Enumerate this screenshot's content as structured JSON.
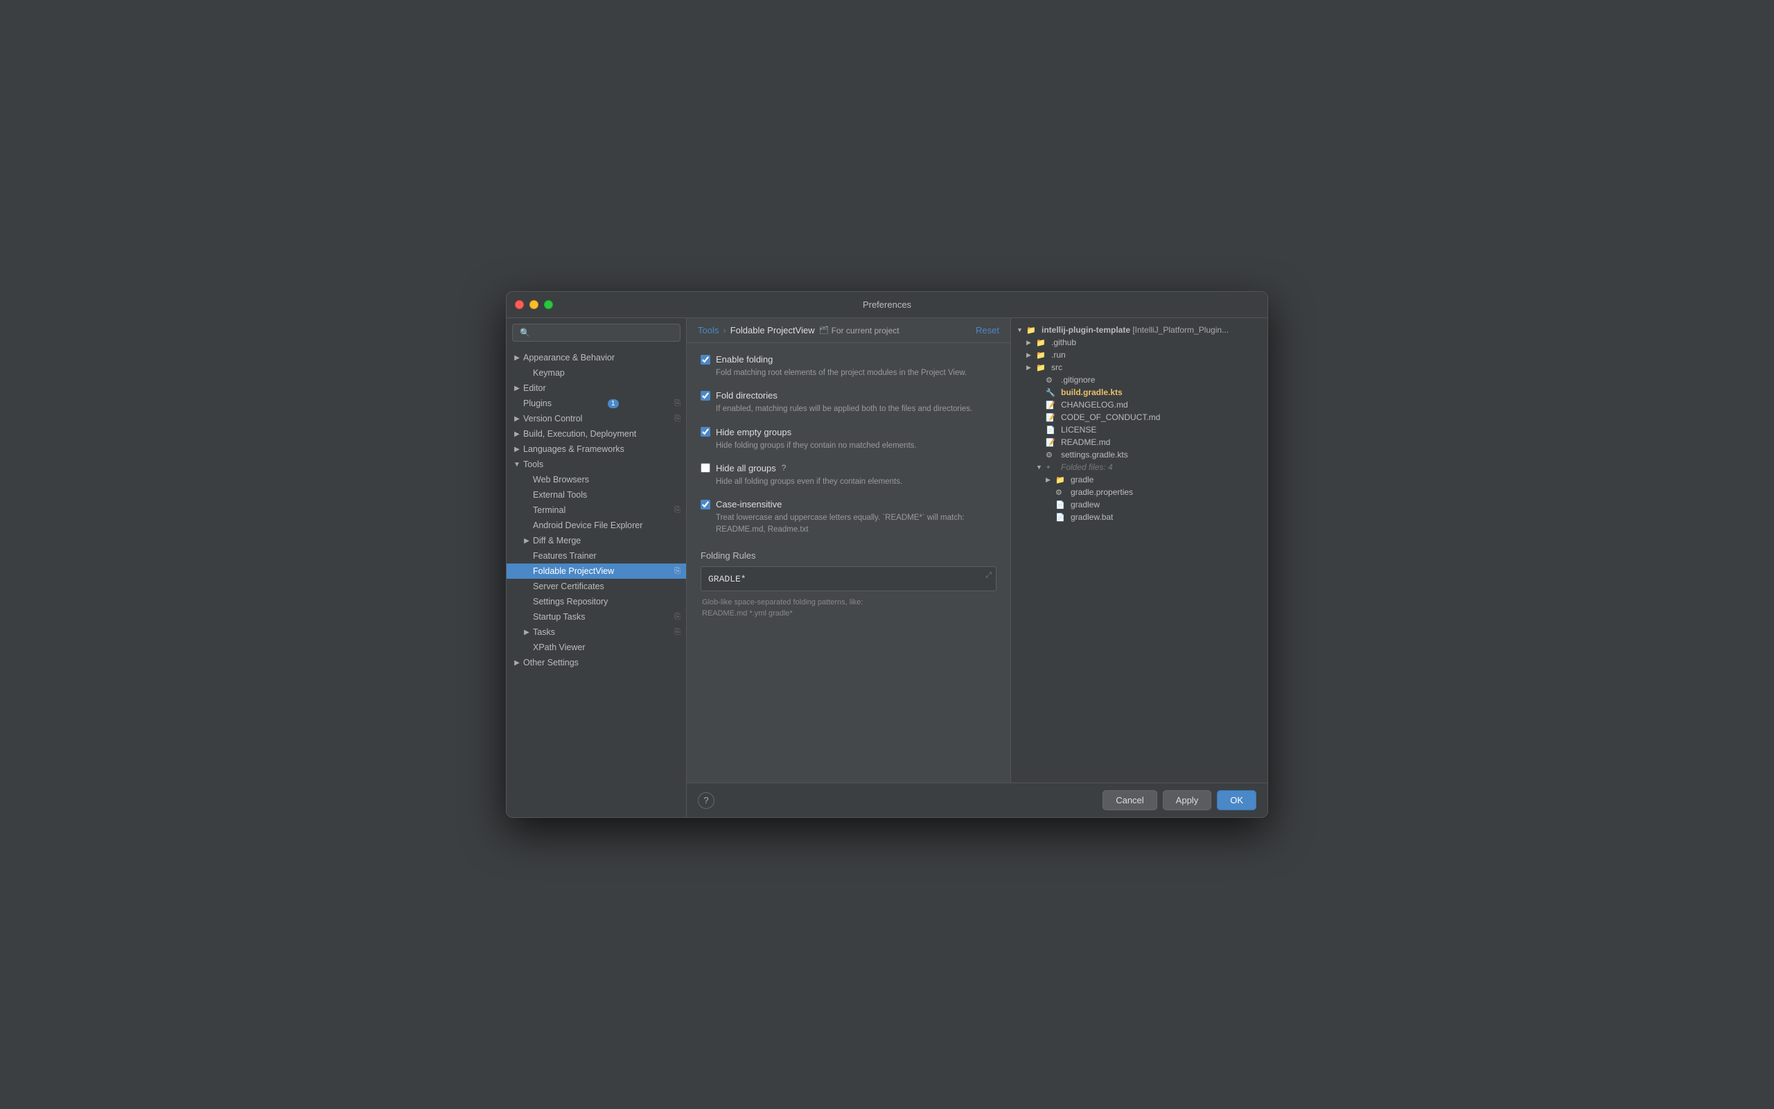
{
  "dialog": {
    "title": "Preferences"
  },
  "titlebar": {
    "buttons": {
      "close": "close",
      "minimize": "minimize",
      "maximize": "maximize"
    }
  },
  "sidebar": {
    "search_placeholder": "🔍",
    "items": [
      {
        "id": "appearance-behavior",
        "label": "Appearance & Behavior",
        "indent": 0,
        "arrow": "▶",
        "has_arrow": true
      },
      {
        "id": "keymap",
        "label": "Keymap",
        "indent": 1,
        "has_arrow": false
      },
      {
        "id": "editor",
        "label": "Editor",
        "indent": 0,
        "arrow": "▶",
        "has_arrow": true
      },
      {
        "id": "plugins",
        "label": "Plugins",
        "indent": 0,
        "has_arrow": false,
        "badge": "1",
        "copy": true
      },
      {
        "id": "version-control",
        "label": "Version Control",
        "indent": 0,
        "arrow": "▶",
        "has_arrow": true,
        "copy": true
      },
      {
        "id": "build-execution-deployment",
        "label": "Build, Execution, Deployment",
        "indent": 0,
        "arrow": "▶",
        "has_arrow": true
      },
      {
        "id": "languages-frameworks",
        "label": "Languages & Frameworks",
        "indent": 0,
        "arrow": "▶",
        "has_arrow": true
      },
      {
        "id": "tools",
        "label": "Tools",
        "indent": 0,
        "arrow": "▼",
        "has_arrow": true,
        "expanded": true
      },
      {
        "id": "web-browsers",
        "label": "Web Browsers",
        "indent": 1,
        "has_arrow": false
      },
      {
        "id": "external-tools",
        "label": "External Tools",
        "indent": 1,
        "has_arrow": false
      },
      {
        "id": "terminal",
        "label": "Terminal",
        "indent": 1,
        "has_arrow": false,
        "copy": true
      },
      {
        "id": "android-device-file-explorer",
        "label": "Android Device File Explorer",
        "indent": 1,
        "has_arrow": false
      },
      {
        "id": "diff-merge",
        "label": "Diff & Merge",
        "indent": 1,
        "arrow": "▶",
        "has_arrow": true
      },
      {
        "id": "features-trainer",
        "label": "Features Trainer",
        "indent": 1,
        "has_arrow": false
      },
      {
        "id": "foldable-projectview",
        "label": "Foldable ProjectView",
        "indent": 1,
        "has_arrow": false,
        "selected": true,
        "copy": true
      },
      {
        "id": "server-certificates",
        "label": "Server Certificates",
        "indent": 1,
        "has_arrow": false
      },
      {
        "id": "settings-repository",
        "label": "Settings Repository",
        "indent": 1,
        "has_arrow": false
      },
      {
        "id": "startup-tasks",
        "label": "Startup Tasks",
        "indent": 1,
        "has_arrow": false,
        "copy": true
      },
      {
        "id": "tasks",
        "label": "Tasks",
        "indent": 1,
        "arrow": "▶",
        "has_arrow": true,
        "copy": true
      },
      {
        "id": "xpath-viewer",
        "label": "XPath Viewer",
        "indent": 1,
        "has_arrow": false
      },
      {
        "id": "other-settings",
        "label": "Other Settings",
        "indent": 0,
        "arrow": "▶",
        "has_arrow": true
      }
    ]
  },
  "breadcrumb": {
    "parent": "Tools",
    "separator": "›",
    "current": "Foldable ProjectView",
    "for_current": "For current project",
    "reset": "Reset"
  },
  "settings": {
    "items": [
      {
        "id": "enable-folding",
        "checked": true,
        "label": "Enable folding",
        "description": "Fold matching root elements of the project modules in the Project View."
      },
      {
        "id": "fold-directories",
        "checked": true,
        "label": "Fold directories",
        "description": "If enabled, matching rules will be applied both to the files and directories."
      },
      {
        "id": "hide-empty-groups",
        "checked": true,
        "label": "Hide empty groups",
        "description": "Hide folding groups if they contain no matched elements."
      },
      {
        "id": "hide-all-groups",
        "checked": false,
        "label": "Hide all groups",
        "has_help": true,
        "description": "Hide all folding groups even if they contain elements."
      },
      {
        "id": "case-insensitive",
        "checked": true,
        "label": "Case-insensitive",
        "description": "Treat lowercase and uppercase letters equally. `README*` will match: README.md, Readme.txt"
      }
    ],
    "folding_rules": {
      "label": "Folding Rules",
      "value": "GRADLE*",
      "hint": "Glob-like space-separated folding patterns, like:\nREADME.md *.yml gradle*"
    }
  },
  "file_tree": {
    "items": [
      {
        "id": "root",
        "indent": 0,
        "arrow": "▼",
        "icon": "📁",
        "name": "intellij-plugin-template",
        "suffix": " [IntelliJ_Platform_Plugin",
        "bold": false,
        "root": true
      },
      {
        "id": "github",
        "indent": 1,
        "arrow": "▶",
        "icon": "📁",
        "name": ".github",
        "bold": false
      },
      {
        "id": "run",
        "indent": 1,
        "arrow": "▶",
        "icon": "📁",
        "name": ".run",
        "bold": false
      },
      {
        "id": "src",
        "indent": 1,
        "arrow": "▶",
        "icon": "📁",
        "name": "src",
        "bold": false
      },
      {
        "id": "gitignore",
        "indent": 2,
        "arrow": "",
        "icon": "⚙️",
        "name": ".gitignore",
        "bold": false
      },
      {
        "id": "build-gradle-kts",
        "indent": 2,
        "arrow": "",
        "icon": "📄",
        "name": "build.gradle.kts",
        "bold": true
      },
      {
        "id": "changelog",
        "indent": 2,
        "arrow": "",
        "icon": "📄",
        "name": "CHANGELOG.md",
        "bold": false
      },
      {
        "id": "code-of-conduct",
        "indent": 2,
        "arrow": "",
        "icon": "📄",
        "name": "CODE_OF_CONDUCT.md",
        "bold": false
      },
      {
        "id": "license",
        "indent": 2,
        "arrow": "",
        "icon": "📄",
        "name": "LICENSE",
        "bold": false
      },
      {
        "id": "readme",
        "indent": 2,
        "arrow": "",
        "icon": "📄",
        "name": "README.md",
        "bold": false
      },
      {
        "id": "settings-gradle-kts",
        "indent": 2,
        "arrow": "",
        "icon": "⚙️",
        "name": "settings.gradle.kts",
        "bold": false
      },
      {
        "id": "folded-files",
        "indent": 2,
        "arrow": "▼",
        "icon": "",
        "name": "Folded files: 4",
        "bold": false,
        "folded": true
      },
      {
        "id": "gradle-dir",
        "indent": 3,
        "arrow": "▶",
        "icon": "📁",
        "name": "gradle",
        "bold": false
      },
      {
        "id": "gradle-properties",
        "indent": 3,
        "arrow": "",
        "icon": "⚙️",
        "name": "gradle.properties",
        "bold": false
      },
      {
        "id": "gradlew",
        "indent": 3,
        "arrow": "",
        "icon": "📄",
        "name": "gradlew",
        "bold": false
      },
      {
        "id": "gradlew-bat",
        "indent": 3,
        "arrow": "",
        "icon": "📄",
        "name": "gradlew.bat",
        "bold": false
      }
    ]
  },
  "bottom": {
    "help_label": "?",
    "cancel": "Cancel",
    "apply": "Apply",
    "ok": "OK"
  }
}
